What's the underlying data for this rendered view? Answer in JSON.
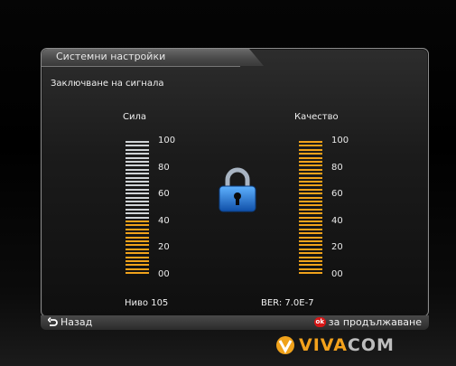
{
  "window": {
    "title": "Системни настройки"
  },
  "subtitle": "Заключване на сигнала",
  "strength": {
    "label": "Сила",
    "level_text": "Ниво 105",
    "filled_fraction": 0.4
  },
  "quality": {
    "label": "Качество",
    "ber_text": "BER: 7.0E-7",
    "filled_fraction": 1.0
  },
  "scale_ticks": [
    "100",
    "80",
    "60",
    "40",
    "20",
    "00"
  ],
  "footer": {
    "back_label": "Назад",
    "ok_badge": "ok",
    "continue_label": "за продължаване"
  },
  "brand": {
    "name_part1": "VIVA",
    "name_part2": "COM"
  },
  "colors": {
    "accent": "#f0a21b",
    "inactive": "#cfd3d6",
    "lock": "#1e74d6"
  },
  "icons": [
    "back-arrow-icon",
    "ok-button-icon",
    "lock-icon",
    "vivacom-logo-icon"
  ]
}
